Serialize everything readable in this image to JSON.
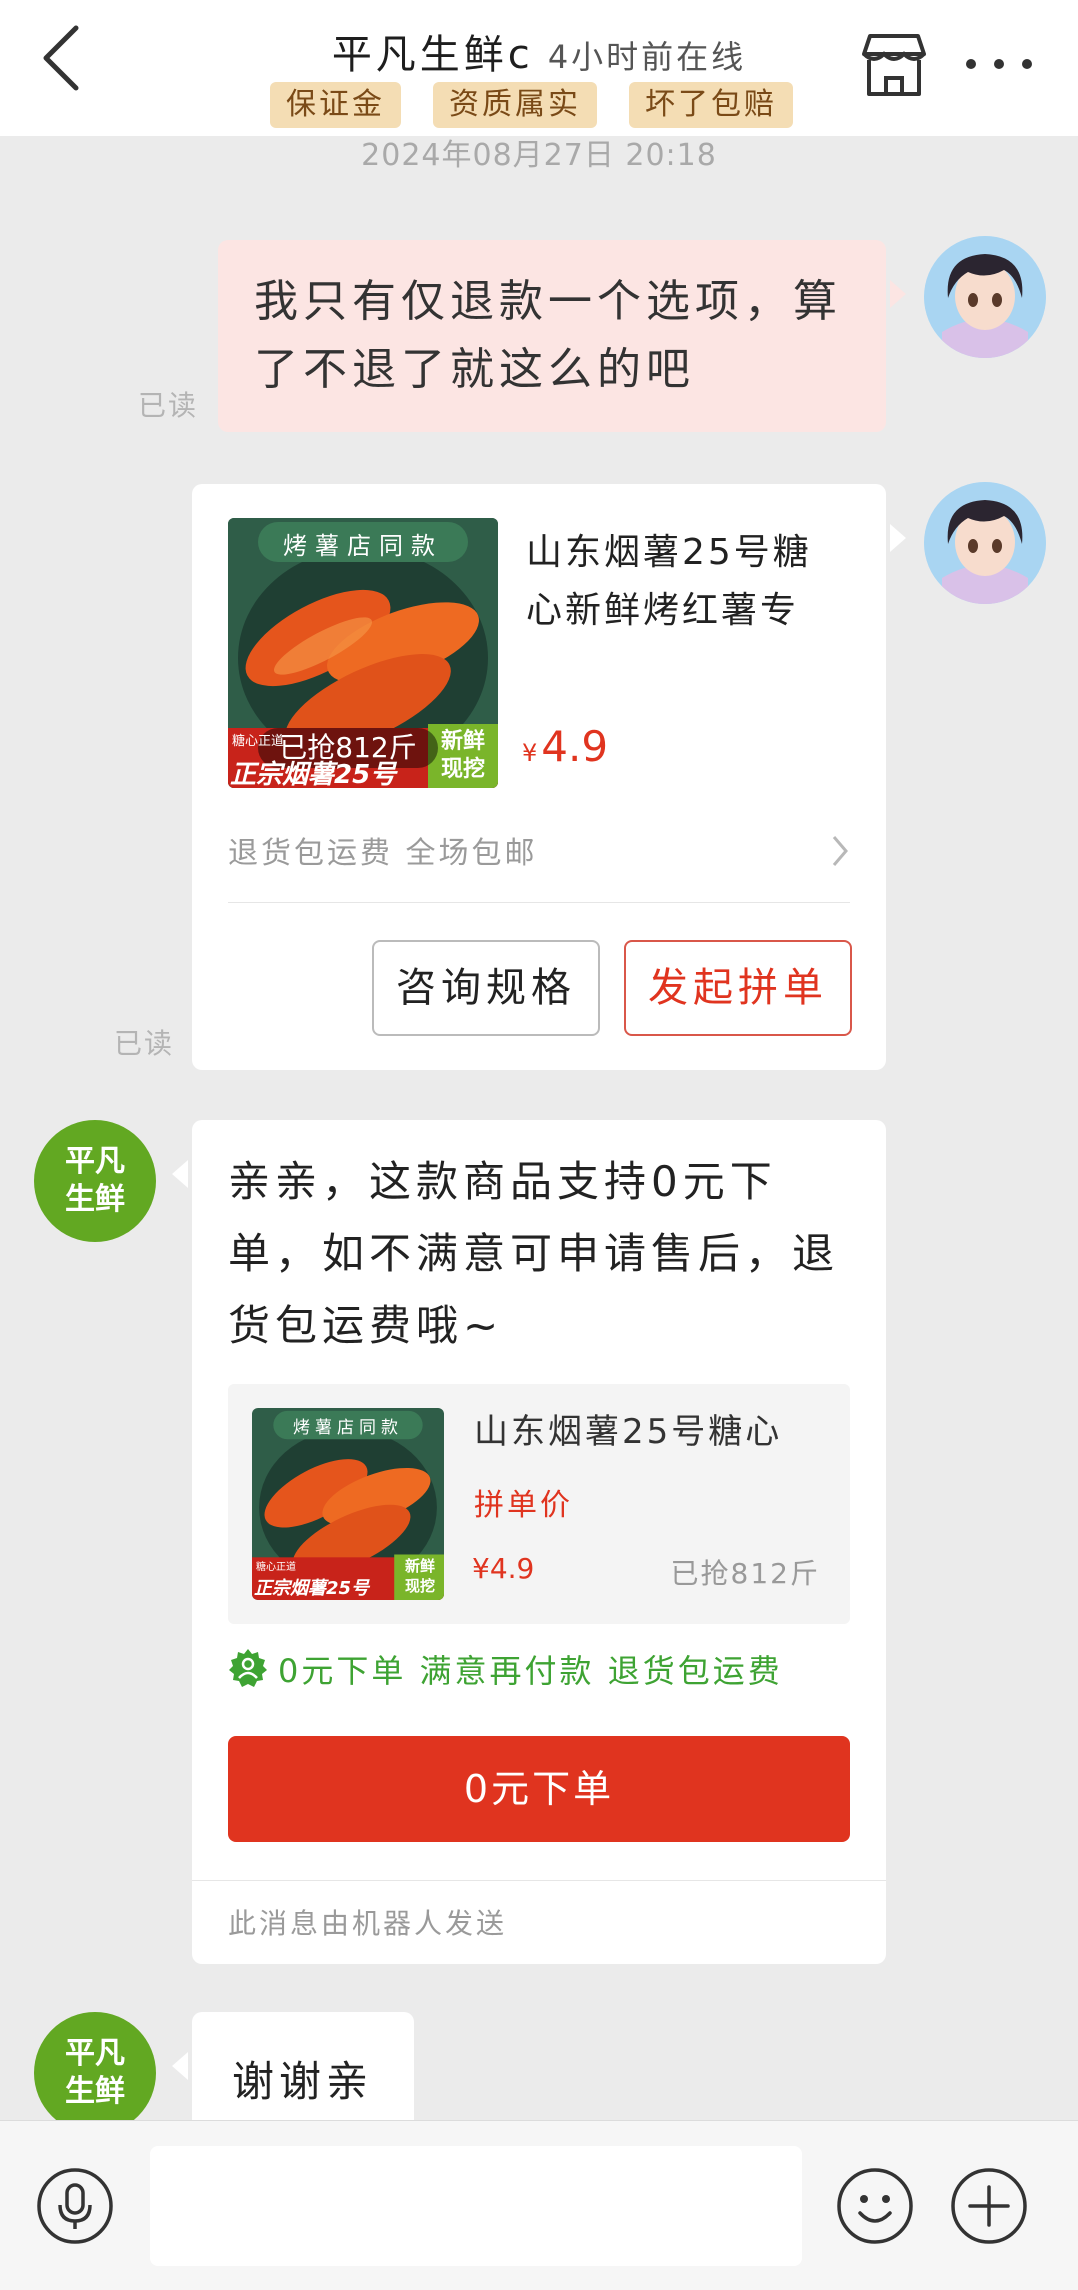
{
  "header": {
    "title": "平凡生鲜c",
    "status": "4小时前在线",
    "badges": [
      "保证金",
      "资质属实",
      "坏了包赔"
    ]
  },
  "timestamp": "2024年08月27日 20:18",
  "messages": {
    "msg1": {
      "text": "我只有仅退款一个选项，算了不退了就这么的吧",
      "read": "已读"
    },
    "product_card": {
      "image_tag": "烤薯店同款",
      "image_sold": "已抢812斤",
      "image_brand": "正宗烟薯25号",
      "image_fresh": "新鲜现挖",
      "image_note": "糖心正道",
      "title": "山东烟薯25号糖心新鲜烤红薯专",
      "price_symbol": "¥",
      "price": "4.9",
      "service": "退货包运费 全场包邮",
      "btn_consult": "咨询规格",
      "btn_group": "发起拼单",
      "read": "已读"
    },
    "bot_msg": {
      "avatar_line1": "平凡",
      "avatar_line2": "生鲜",
      "text": "亲亲，这款商品支持0元下单，如不满意可申请售后，退货包运费哦~",
      "product_title": "山东烟薯25号糖心",
      "group_price_label": "拼单价",
      "price": "¥4.9",
      "sold": "已抢812斤",
      "image_tag": "烤薯店同款",
      "image_brand": "正宗烟薯25号",
      "image_fresh": "新鲜现挖",
      "image_note": "糖心正道",
      "guarantee": "0元下单 满意再付款 退货包运费",
      "order_btn": "0元下单",
      "footer": "此消息由机器人发送"
    },
    "bot_msg2": {
      "avatar_line1": "平凡",
      "avatar_line2": "生鲜",
      "text": "谢谢亲"
    }
  },
  "input": {
    "placeholder": ""
  },
  "colors": {
    "accent_red": "#e0341f",
    "badge_bg": "#f4ddb4",
    "shop_green": "#62a822",
    "guarantee_green": "#3ea333"
  },
  "icons": [
    "back-icon",
    "store-icon",
    "more-icon",
    "microphone-icon",
    "emoji-icon",
    "plus-icon",
    "chevron-right-icon",
    "guarantee-icon"
  ]
}
